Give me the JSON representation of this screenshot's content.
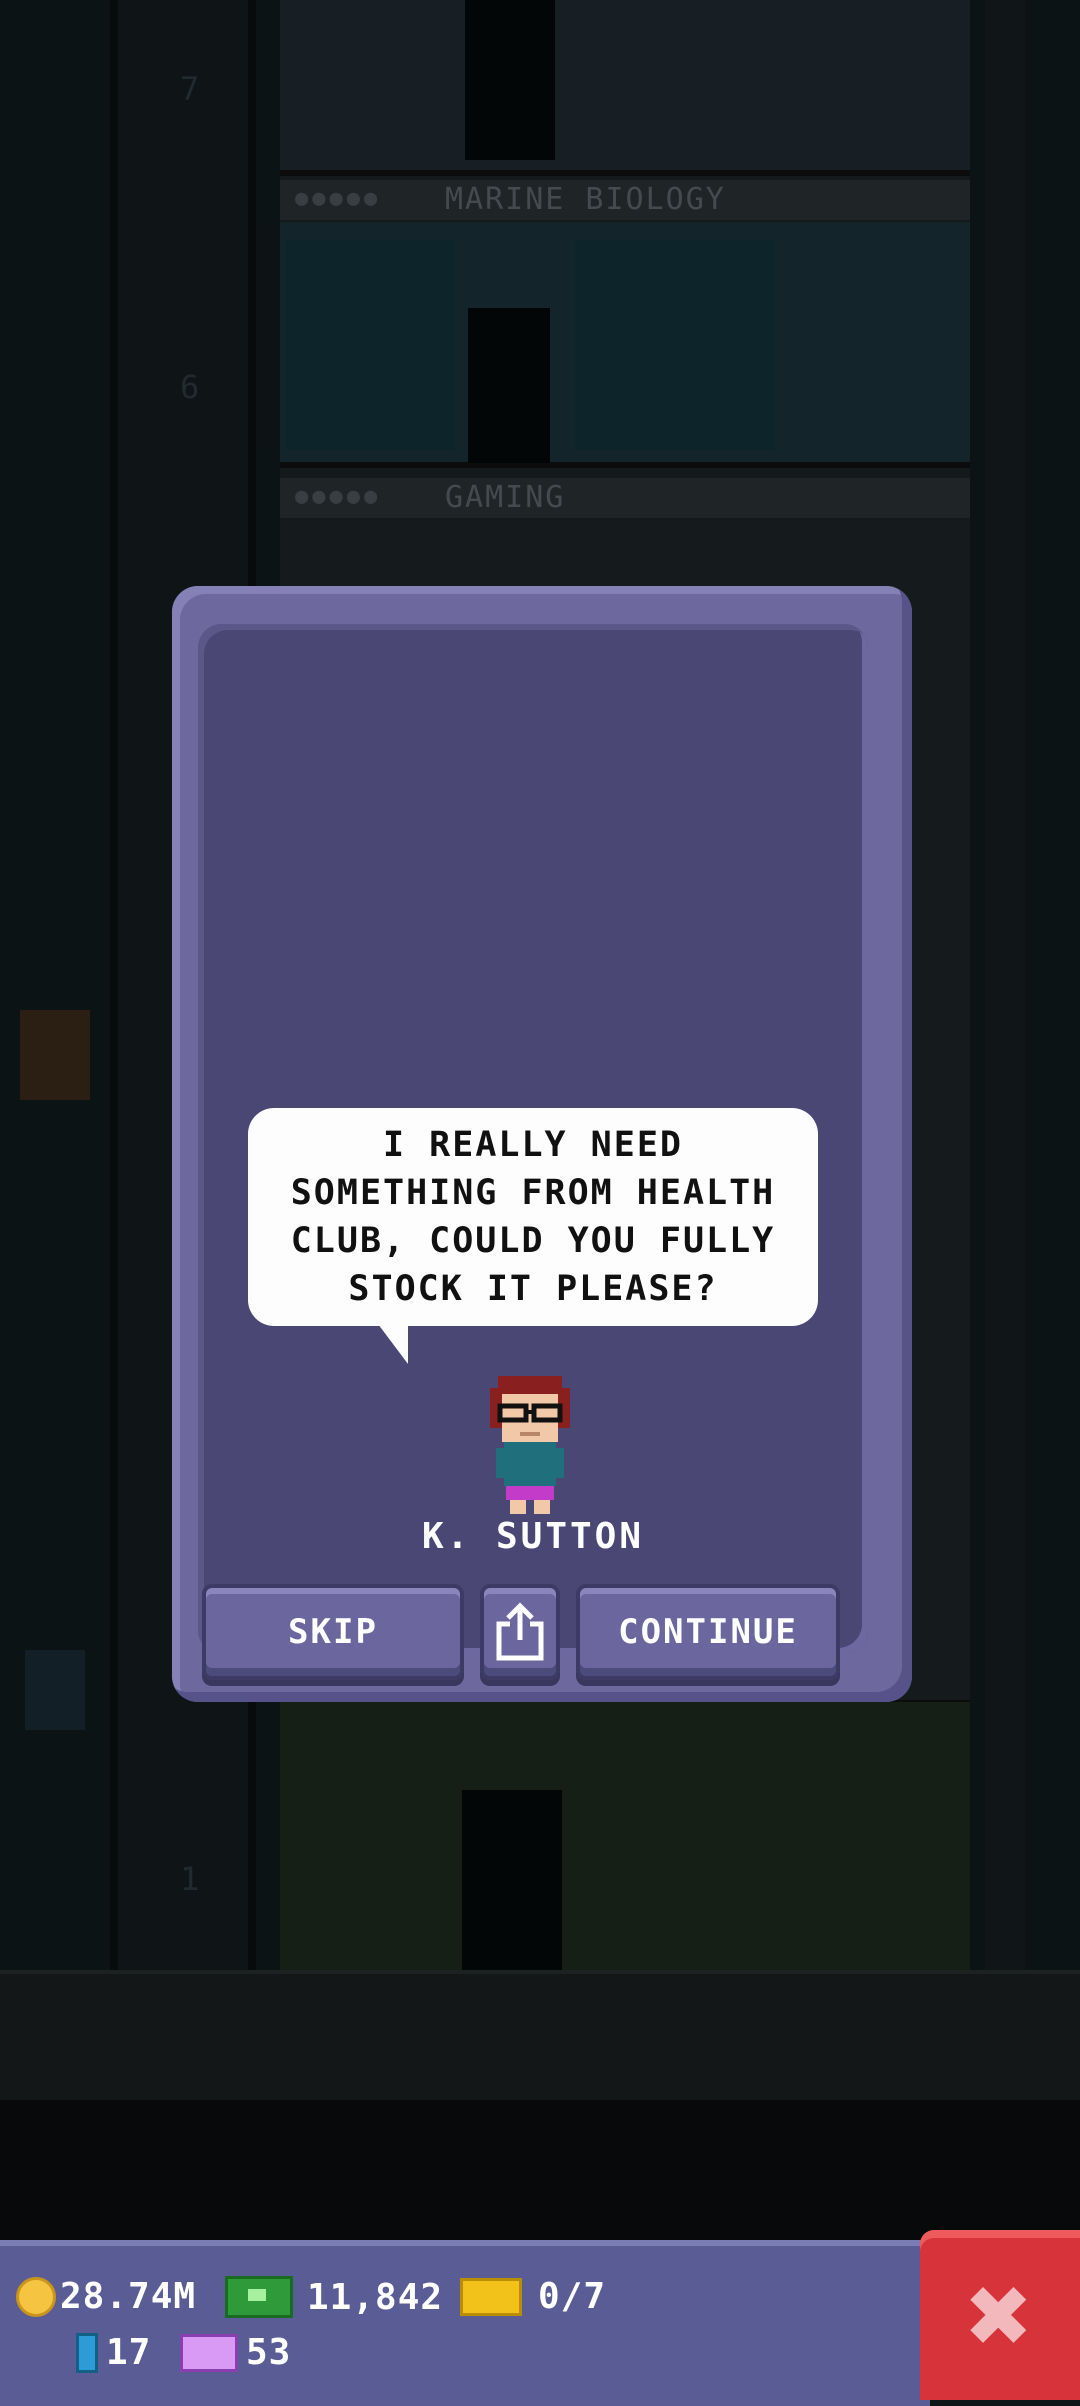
{
  "tower": {
    "floors": [
      {
        "number": "7",
        "name": ""
      },
      {
        "number": "6",
        "name": "MARINE BIOLOGY"
      },
      {
        "number": "",
        "name": "GAMING"
      },
      {
        "number": "1",
        "name": ""
      }
    ]
  },
  "dialog": {
    "message": "I REALLY NEED SOMETHING FROM HEALTH CLUB, COULD YOU FULLY STOCK IT PLEASE?",
    "character_name": "K. SUTTON",
    "skip_label": "SKIP",
    "share_icon": "share-icon",
    "continue_label": "CONTINUE"
  },
  "hud": {
    "coins": "28.74M",
    "bux": "11,842",
    "tickets": "0/7",
    "crates": "17",
    "vip": "53",
    "close_icon": "close-icon",
    "close_glyph": "✖"
  },
  "colors": {
    "dialog_frame": "#6d689e",
    "dialog_inner": "#4a4775",
    "button": "#6b679e",
    "close_button": "#d6333a",
    "hud_bar": "#5a5d95"
  }
}
